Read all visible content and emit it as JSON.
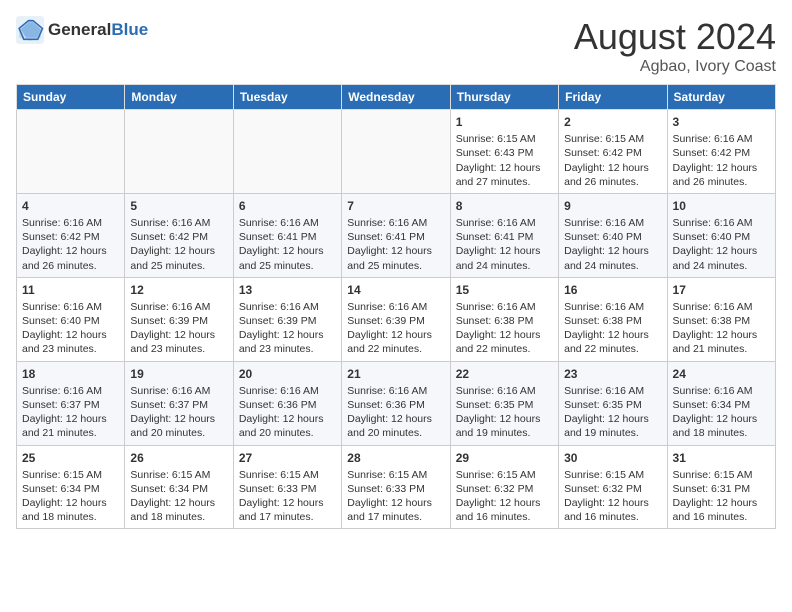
{
  "logo": {
    "text_general": "General",
    "text_blue": "Blue"
  },
  "title": "August 2024",
  "subtitle": "Agbao, Ivory Coast",
  "headers": [
    "Sunday",
    "Monday",
    "Tuesday",
    "Wednesday",
    "Thursday",
    "Friday",
    "Saturday"
  ],
  "weeks": [
    [
      {
        "day": "",
        "info": ""
      },
      {
        "day": "",
        "info": ""
      },
      {
        "day": "",
        "info": ""
      },
      {
        "day": "",
        "info": ""
      },
      {
        "day": "1",
        "info": "Sunrise: 6:15 AM\nSunset: 6:43 PM\nDaylight: 12 hours\nand 27 minutes."
      },
      {
        "day": "2",
        "info": "Sunrise: 6:15 AM\nSunset: 6:42 PM\nDaylight: 12 hours\nand 26 minutes."
      },
      {
        "day": "3",
        "info": "Sunrise: 6:16 AM\nSunset: 6:42 PM\nDaylight: 12 hours\nand 26 minutes."
      }
    ],
    [
      {
        "day": "4",
        "info": "Sunrise: 6:16 AM\nSunset: 6:42 PM\nDaylight: 12 hours\nand 26 minutes."
      },
      {
        "day": "5",
        "info": "Sunrise: 6:16 AM\nSunset: 6:42 PM\nDaylight: 12 hours\nand 25 minutes."
      },
      {
        "day": "6",
        "info": "Sunrise: 6:16 AM\nSunset: 6:41 PM\nDaylight: 12 hours\nand 25 minutes."
      },
      {
        "day": "7",
        "info": "Sunrise: 6:16 AM\nSunset: 6:41 PM\nDaylight: 12 hours\nand 25 minutes."
      },
      {
        "day": "8",
        "info": "Sunrise: 6:16 AM\nSunset: 6:41 PM\nDaylight: 12 hours\nand 24 minutes."
      },
      {
        "day": "9",
        "info": "Sunrise: 6:16 AM\nSunset: 6:40 PM\nDaylight: 12 hours\nand 24 minutes."
      },
      {
        "day": "10",
        "info": "Sunrise: 6:16 AM\nSunset: 6:40 PM\nDaylight: 12 hours\nand 24 minutes."
      }
    ],
    [
      {
        "day": "11",
        "info": "Sunrise: 6:16 AM\nSunset: 6:40 PM\nDaylight: 12 hours\nand 23 minutes."
      },
      {
        "day": "12",
        "info": "Sunrise: 6:16 AM\nSunset: 6:39 PM\nDaylight: 12 hours\nand 23 minutes."
      },
      {
        "day": "13",
        "info": "Sunrise: 6:16 AM\nSunset: 6:39 PM\nDaylight: 12 hours\nand 23 minutes."
      },
      {
        "day": "14",
        "info": "Sunrise: 6:16 AM\nSunset: 6:39 PM\nDaylight: 12 hours\nand 22 minutes."
      },
      {
        "day": "15",
        "info": "Sunrise: 6:16 AM\nSunset: 6:38 PM\nDaylight: 12 hours\nand 22 minutes."
      },
      {
        "day": "16",
        "info": "Sunrise: 6:16 AM\nSunset: 6:38 PM\nDaylight: 12 hours\nand 22 minutes."
      },
      {
        "day": "17",
        "info": "Sunrise: 6:16 AM\nSunset: 6:38 PM\nDaylight: 12 hours\nand 21 minutes."
      }
    ],
    [
      {
        "day": "18",
        "info": "Sunrise: 6:16 AM\nSunset: 6:37 PM\nDaylight: 12 hours\nand 21 minutes."
      },
      {
        "day": "19",
        "info": "Sunrise: 6:16 AM\nSunset: 6:37 PM\nDaylight: 12 hours\nand 20 minutes."
      },
      {
        "day": "20",
        "info": "Sunrise: 6:16 AM\nSunset: 6:36 PM\nDaylight: 12 hours\nand 20 minutes."
      },
      {
        "day": "21",
        "info": "Sunrise: 6:16 AM\nSunset: 6:36 PM\nDaylight: 12 hours\nand 20 minutes."
      },
      {
        "day": "22",
        "info": "Sunrise: 6:16 AM\nSunset: 6:35 PM\nDaylight: 12 hours\nand 19 minutes."
      },
      {
        "day": "23",
        "info": "Sunrise: 6:16 AM\nSunset: 6:35 PM\nDaylight: 12 hours\nand 19 minutes."
      },
      {
        "day": "24",
        "info": "Sunrise: 6:16 AM\nSunset: 6:34 PM\nDaylight: 12 hours\nand 18 minutes."
      }
    ],
    [
      {
        "day": "25",
        "info": "Sunrise: 6:15 AM\nSunset: 6:34 PM\nDaylight: 12 hours\nand 18 minutes."
      },
      {
        "day": "26",
        "info": "Sunrise: 6:15 AM\nSunset: 6:34 PM\nDaylight: 12 hours\nand 18 minutes."
      },
      {
        "day": "27",
        "info": "Sunrise: 6:15 AM\nSunset: 6:33 PM\nDaylight: 12 hours\nand 17 minutes."
      },
      {
        "day": "28",
        "info": "Sunrise: 6:15 AM\nSunset: 6:33 PM\nDaylight: 12 hours\nand 17 minutes."
      },
      {
        "day": "29",
        "info": "Sunrise: 6:15 AM\nSunset: 6:32 PM\nDaylight: 12 hours\nand 16 minutes."
      },
      {
        "day": "30",
        "info": "Sunrise: 6:15 AM\nSunset: 6:32 PM\nDaylight: 12 hours\nand 16 minutes."
      },
      {
        "day": "31",
        "info": "Sunrise: 6:15 AM\nSunset: 6:31 PM\nDaylight: 12 hours\nand 16 minutes."
      }
    ]
  ]
}
